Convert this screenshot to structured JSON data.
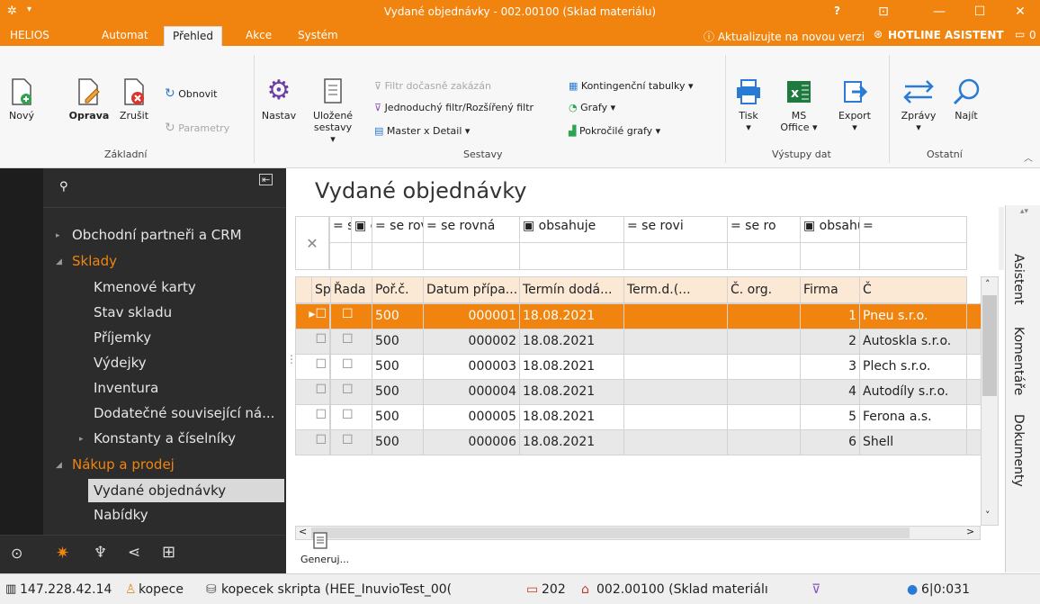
{
  "window": {
    "title": "Vydané objednávky - 002.00100 (Sklad materiálu)",
    "help": "?",
    "buttons": [
      "—",
      "☐",
      "✕"
    ]
  },
  "menu": {
    "tabs": [
      "HELIOS",
      "Automat",
      "Přehled",
      "Akce",
      "Systém"
    ],
    "active": "Přehled",
    "update_notice": "ⓘ Aktualizujte na novou verzi",
    "hotline": "HOTLINE ASISTENT",
    "messages": "0"
  },
  "ribbon": {
    "zakladni": {
      "group": "Základní",
      "novy": "Nový",
      "oprava": "Oprava",
      "zrusit": "Zrušit",
      "obnovit": "Obnovit",
      "parametry": "Parametry"
    },
    "sestavy": {
      "group": "Sestavy",
      "nastav": "Nastav",
      "ulozene1": "Uložené",
      "ulozene2": "sestavy ▾",
      "filtr_docasne": "Filtr dočasně zakázán",
      "jednoduchy_filtr": "Jednoduchý filtr/Rozšířený filtr",
      "master_detail": "Master x Detail ▾",
      "kontingencni": "Kontingenční tabulky ▾",
      "grafy": "Grafy ▾",
      "pokrocile_grafy": "Pokročilé grafy ▾"
    },
    "vystupy": {
      "group": "Výstupy dat",
      "tisk": "Tisk",
      "tisk_dd": "▾",
      "ms1": "MS",
      "ms2": "Office ▾",
      "export": "Export",
      "export_dd": "▾"
    },
    "ostatni": {
      "group": "Ostatní",
      "zpravy": "Zprávy",
      "zpravy_dd": "▾",
      "najit": "Najít"
    }
  },
  "nav": {
    "items": [
      {
        "label": "Obchodní partneři a CRM",
        "style": "normal"
      },
      {
        "label": "Sklady",
        "style": "orange"
      },
      {
        "label": "Kmenové karty",
        "style": "normal"
      },
      {
        "label": "Stav skladu",
        "style": "normal"
      },
      {
        "label": "Příjemky",
        "style": "normal"
      },
      {
        "label": "Výdejky",
        "style": "normal"
      },
      {
        "label": "Inventura",
        "style": "normal"
      },
      {
        "label": "Dodatečné související ná...",
        "style": "normal"
      },
      {
        "label": "Konstanty a číselníky",
        "style": "normal"
      },
      {
        "label": "Nákup a prodej",
        "style": "orange"
      },
      {
        "label": "Vydané objednávky",
        "style": "selected"
      },
      {
        "label": "Nabídky",
        "style": "normal"
      }
    ]
  },
  "main": {
    "page_title": "Vydané objednávky",
    "filter_row": [
      "= se",
      "▣ obs",
      "= se rovná",
      "= se rovná",
      "▣ obsahuje",
      "= se rovi",
      "= se ro",
      "▣ obsahuje",
      "="
    ],
    "columns": [
      "Sp",
      "Řada",
      "Poř.č.",
      "Datum přípa...",
      "Termín dodá...",
      "Term.d.(...",
      "Č. org.",
      "Firma",
      "Č"
    ],
    "rows": [
      {
        "rada": "500",
        "porc": "000001",
        "datum": "18.08.2021",
        "corg": "1",
        "firma": "Pneu s.r.o."
      },
      {
        "rada": "500",
        "porc": "000002",
        "datum": "18.08.2021",
        "corg": "2",
        "firma": "Autoskla s.r.o."
      },
      {
        "rada": "500",
        "porc": "000003",
        "datum": "18.08.2021",
        "corg": "3",
        "firma": "Plech s.r.o."
      },
      {
        "rada": "500",
        "porc": "000004",
        "datum": "18.08.2021",
        "corg": "4",
        "firma": "Autodíly s.r.o."
      },
      {
        "rada": "500",
        "porc": "000005",
        "datum": "18.08.2021",
        "corg": "5",
        "firma": "Ferona a.s."
      },
      {
        "rada": "500",
        "porc": "000006",
        "datum": "18.08.2021",
        "corg": "6",
        "firma": "Shell"
      }
    ],
    "generuj": "Generuj..."
  },
  "right_tabs": [
    "Asistent",
    "Komentáře",
    "Dokumenty"
  ],
  "status": {
    "ip": "147.228.42.14",
    "user": "kopece",
    "db": "kopecek skripta (HEE_InuvioTest_00(",
    "cal": "202",
    "sklad": "002.00100 (Sklad materiálı",
    "count": "6|0:031"
  },
  "colors": {
    "accent": "#f1840f",
    "nav_bg": "#2c2c2c"
  }
}
